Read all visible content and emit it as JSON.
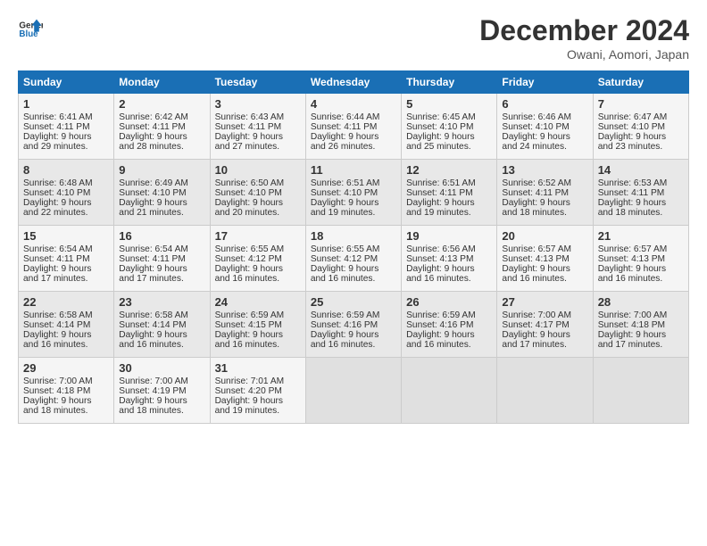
{
  "logo": {
    "line1": "General",
    "line2": "Blue"
  },
  "title": "December 2024",
  "subtitle": "Owani, Aomori, Japan",
  "days_of_week": [
    "Sunday",
    "Monday",
    "Tuesday",
    "Wednesday",
    "Thursday",
    "Friday",
    "Saturday"
  ],
  "weeks": [
    [
      {
        "day": "1",
        "lines": [
          "Sunrise: 6:41 AM",
          "Sunset: 4:11 PM",
          "Daylight: 9 hours",
          "and 29 minutes."
        ]
      },
      {
        "day": "2",
        "lines": [
          "Sunrise: 6:42 AM",
          "Sunset: 4:11 PM",
          "Daylight: 9 hours",
          "and 28 minutes."
        ]
      },
      {
        "day": "3",
        "lines": [
          "Sunrise: 6:43 AM",
          "Sunset: 4:11 PM",
          "Daylight: 9 hours",
          "and 27 minutes."
        ]
      },
      {
        "day": "4",
        "lines": [
          "Sunrise: 6:44 AM",
          "Sunset: 4:11 PM",
          "Daylight: 9 hours",
          "and 26 minutes."
        ]
      },
      {
        "day": "5",
        "lines": [
          "Sunrise: 6:45 AM",
          "Sunset: 4:10 PM",
          "Daylight: 9 hours",
          "and 25 minutes."
        ]
      },
      {
        "day": "6",
        "lines": [
          "Sunrise: 6:46 AM",
          "Sunset: 4:10 PM",
          "Daylight: 9 hours",
          "and 24 minutes."
        ]
      },
      {
        "day": "7",
        "lines": [
          "Sunrise: 6:47 AM",
          "Sunset: 4:10 PM",
          "Daylight: 9 hours",
          "and 23 minutes."
        ]
      }
    ],
    [
      {
        "day": "8",
        "lines": [
          "Sunrise: 6:48 AM",
          "Sunset: 4:10 PM",
          "Daylight: 9 hours",
          "and 22 minutes."
        ]
      },
      {
        "day": "9",
        "lines": [
          "Sunrise: 6:49 AM",
          "Sunset: 4:10 PM",
          "Daylight: 9 hours",
          "and 21 minutes."
        ]
      },
      {
        "day": "10",
        "lines": [
          "Sunrise: 6:50 AM",
          "Sunset: 4:10 PM",
          "Daylight: 9 hours",
          "and 20 minutes."
        ]
      },
      {
        "day": "11",
        "lines": [
          "Sunrise: 6:51 AM",
          "Sunset: 4:10 PM",
          "Daylight: 9 hours",
          "and 19 minutes."
        ]
      },
      {
        "day": "12",
        "lines": [
          "Sunrise: 6:51 AM",
          "Sunset: 4:11 PM",
          "Daylight: 9 hours",
          "and 19 minutes."
        ]
      },
      {
        "day": "13",
        "lines": [
          "Sunrise: 6:52 AM",
          "Sunset: 4:11 PM",
          "Daylight: 9 hours",
          "and 18 minutes."
        ]
      },
      {
        "day": "14",
        "lines": [
          "Sunrise: 6:53 AM",
          "Sunset: 4:11 PM",
          "Daylight: 9 hours",
          "and 18 minutes."
        ]
      }
    ],
    [
      {
        "day": "15",
        "lines": [
          "Sunrise: 6:54 AM",
          "Sunset: 4:11 PM",
          "Daylight: 9 hours",
          "and 17 minutes."
        ]
      },
      {
        "day": "16",
        "lines": [
          "Sunrise: 6:54 AM",
          "Sunset: 4:11 PM",
          "Daylight: 9 hours",
          "and 17 minutes."
        ]
      },
      {
        "day": "17",
        "lines": [
          "Sunrise: 6:55 AM",
          "Sunset: 4:12 PM",
          "Daylight: 9 hours",
          "and 16 minutes."
        ]
      },
      {
        "day": "18",
        "lines": [
          "Sunrise: 6:55 AM",
          "Sunset: 4:12 PM",
          "Daylight: 9 hours",
          "and 16 minutes."
        ]
      },
      {
        "day": "19",
        "lines": [
          "Sunrise: 6:56 AM",
          "Sunset: 4:13 PM",
          "Daylight: 9 hours",
          "and 16 minutes."
        ]
      },
      {
        "day": "20",
        "lines": [
          "Sunrise: 6:57 AM",
          "Sunset: 4:13 PM",
          "Daylight: 9 hours",
          "and 16 minutes."
        ]
      },
      {
        "day": "21",
        "lines": [
          "Sunrise: 6:57 AM",
          "Sunset: 4:13 PM",
          "Daylight: 9 hours",
          "and 16 minutes."
        ]
      }
    ],
    [
      {
        "day": "22",
        "lines": [
          "Sunrise: 6:58 AM",
          "Sunset: 4:14 PM",
          "Daylight: 9 hours",
          "and 16 minutes."
        ]
      },
      {
        "day": "23",
        "lines": [
          "Sunrise: 6:58 AM",
          "Sunset: 4:14 PM",
          "Daylight: 9 hours",
          "and 16 minutes."
        ]
      },
      {
        "day": "24",
        "lines": [
          "Sunrise: 6:59 AM",
          "Sunset: 4:15 PM",
          "Daylight: 9 hours",
          "and 16 minutes."
        ]
      },
      {
        "day": "25",
        "lines": [
          "Sunrise: 6:59 AM",
          "Sunset: 4:16 PM",
          "Daylight: 9 hours",
          "and 16 minutes."
        ]
      },
      {
        "day": "26",
        "lines": [
          "Sunrise: 6:59 AM",
          "Sunset: 4:16 PM",
          "Daylight: 9 hours",
          "and 16 minutes."
        ]
      },
      {
        "day": "27",
        "lines": [
          "Sunrise: 7:00 AM",
          "Sunset: 4:17 PM",
          "Daylight: 9 hours",
          "and 17 minutes."
        ]
      },
      {
        "day": "28",
        "lines": [
          "Sunrise: 7:00 AM",
          "Sunset: 4:18 PM",
          "Daylight: 9 hours",
          "and 17 minutes."
        ]
      }
    ],
    [
      {
        "day": "29",
        "lines": [
          "Sunrise: 7:00 AM",
          "Sunset: 4:18 PM",
          "Daylight: 9 hours",
          "and 18 minutes."
        ]
      },
      {
        "day": "30",
        "lines": [
          "Sunrise: 7:00 AM",
          "Sunset: 4:19 PM",
          "Daylight: 9 hours",
          "and 18 minutes."
        ]
      },
      {
        "day": "31",
        "lines": [
          "Sunrise: 7:01 AM",
          "Sunset: 4:20 PM",
          "Daylight: 9 hours",
          "and 19 minutes."
        ]
      },
      null,
      null,
      null,
      null
    ]
  ]
}
